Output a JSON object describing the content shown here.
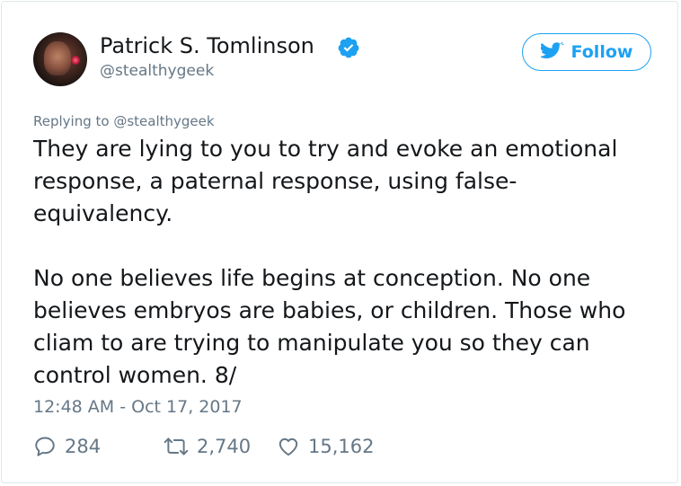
{
  "author": {
    "name": "Patrick S. Tomlinson",
    "handle": "@stealthygeek",
    "verified_icon": "verified-badge-icon",
    "avatar_icon": "avatar"
  },
  "follow_button": {
    "label": "Follow",
    "icon": "twitter-bird-icon"
  },
  "reply_context": {
    "prefix": "Replying to",
    "mention": "@stealthygeek"
  },
  "tweet": {
    "lines": [
      "They are lying to you to try and evoke an emotional",
      "response, a paternal response, using false-",
      "equivalency.",
      "",
      "No one believes life begins at conception. No one",
      "believes embryos are babies, or children. Those who",
      "cliam to are trying to manipulate you so they can",
      "control women. 8/"
    ],
    "timestamp": "12:48 AM - Oct 17, 2017"
  },
  "actions": {
    "replies": "284",
    "retweets": "2,740",
    "likes": "15,162"
  },
  "colors": {
    "brand": "#1da1f2",
    "text": "#14171a",
    "muted": "#657786",
    "border": "#e1e8ed"
  }
}
